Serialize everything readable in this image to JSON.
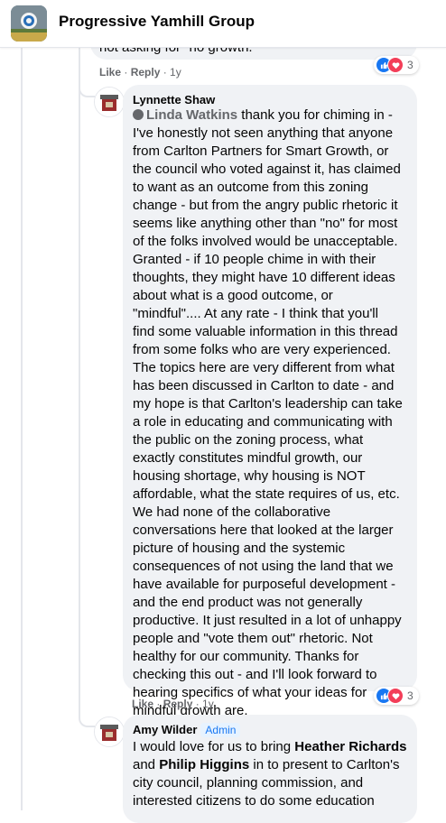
{
  "header": {
    "group_name": "Progressive Yamhill Group"
  },
  "prev_comment": {
    "tail_text": "not asking for \"no growth.\"",
    "like_label": "Like",
    "reply_label": "Reply",
    "age": "1y",
    "reaction_count": "3"
  },
  "comment1": {
    "author": "Lynnette Shaw",
    "mention": "Linda Watkins",
    "lines": [
      " thank you for chiming in -",
      "I've honestly not seen anything that anyone",
      "from Carlton Partners for Smart Growth, or",
      "the council who voted against it, has claimed",
      "to want as an outcome from this zoning",
      "change - but from the angry public rhetoric it",
      "seems like anything other than \"no\" for most",
      "of the folks involved would be unacceptable.",
      "Granted - if 10 people chime in with their",
      "thoughts, they might have 10 different ideas",
      "about what is a good outcome, or",
      "\"mindful\".... At any rate - I think that you'll",
      "find some valuable information in this thread",
      "from some folks who are very experienced.",
      "The topics here are very different from what",
      "has been discussed in Carlton to date - and",
      "my hope is that Carlton's leadership can take",
      "a role in educating and communicating with",
      "the public on the zoning process, what",
      "exactly constitutes mindful growth, our",
      "housing shortage, why housing is NOT",
      "affordable, what the state requires of us, etc.",
      "We had none of the collaborative",
      "conversations here that looked at the larger",
      "picture of housing and the systemic",
      "consequences of not using the land that we",
      "have available for purposeful development -",
      "and the end product was not generally",
      "productive. It just resulted in a lot of unhappy",
      "people and \"vote them out\" rhetoric. Not",
      "healthy for our community. Thanks for",
      "checking this out - and I'll look forward to",
      "hearing specifics of what your ideas for",
      "mindful growth are."
    ],
    "like_label": "Like",
    "reply_label": "Reply",
    "age": "1y",
    "reaction_count": "3"
  },
  "comment2": {
    "author": "Amy Wilder",
    "badge": "Admin",
    "line1_a": "I would love for us to bring ",
    "line1_b": "Heather Richards",
    "line2_a": "and ",
    "line2_b": "Philip Higgins",
    "line2_c": " in to present to Carlton's",
    "line3": "city council, planning commission, and",
    "line4": "interested citizens to do some education"
  },
  "colors": {
    "like_blue": "#1877f2",
    "love_red": "#f33e58",
    "bubble_gray": "#f0f2f5"
  }
}
